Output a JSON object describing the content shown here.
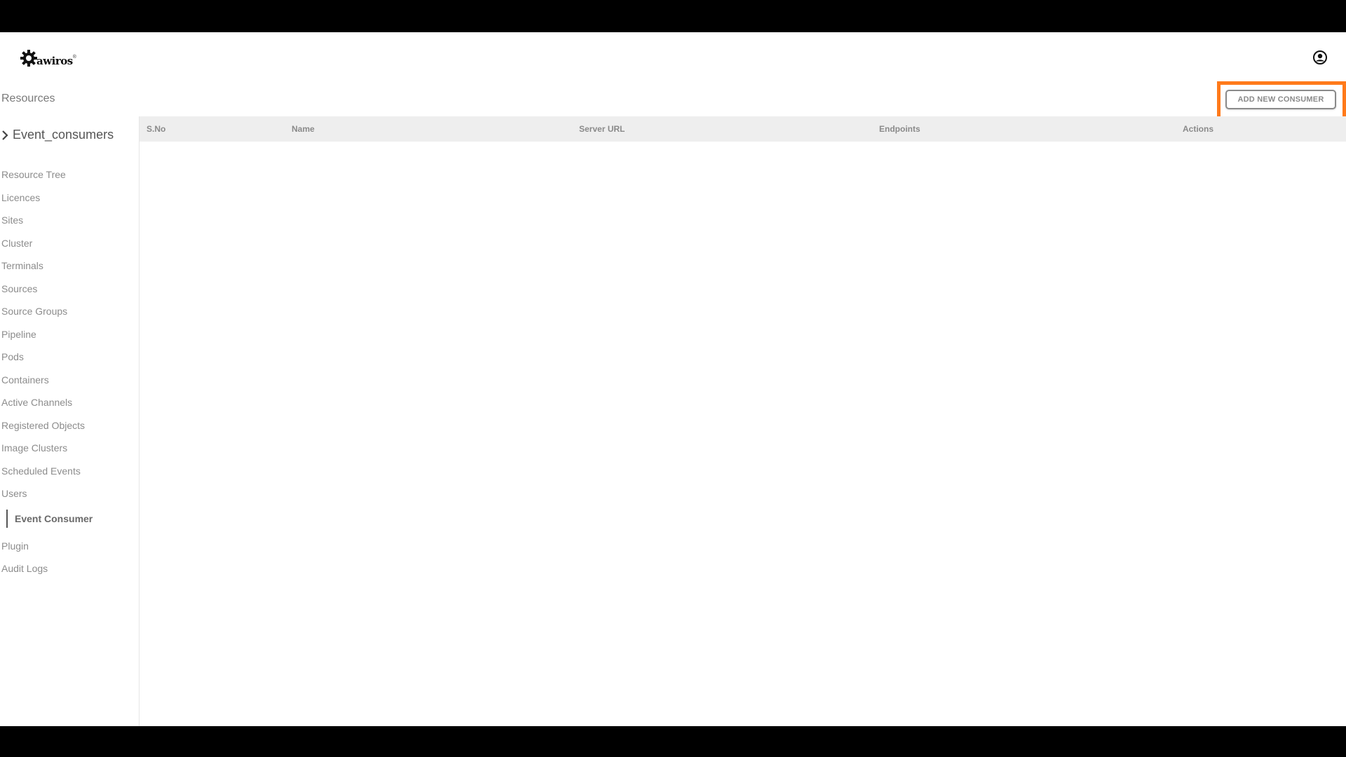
{
  "header": {
    "logo_text": "awiros",
    "logo_mark": "®",
    "account_icon": "account-circle-icon"
  },
  "resources_bar": {
    "title": "Resources",
    "add_button_label": "ADD NEW CONSUMER",
    "highlight_color": "#ff7a1a"
  },
  "sidebar": {
    "breadcrumb": "Event_consumers",
    "items": [
      "Resource Tree",
      "Licences",
      "Sites",
      "Cluster",
      "Terminals",
      "Sources",
      "Source Groups",
      "Pipeline",
      "Pods",
      "Containers",
      "Active Channels",
      "Registered Objects",
      "Image Clusters",
      "Scheduled Events",
      "Users",
      "Event Consumer",
      "Plugin",
      "Audit Logs"
    ],
    "active_item": "Event Consumer"
  },
  "table": {
    "columns": [
      "S.No",
      "Name",
      "Server URL",
      "Endpoints",
      "Actions"
    ],
    "rows": []
  }
}
